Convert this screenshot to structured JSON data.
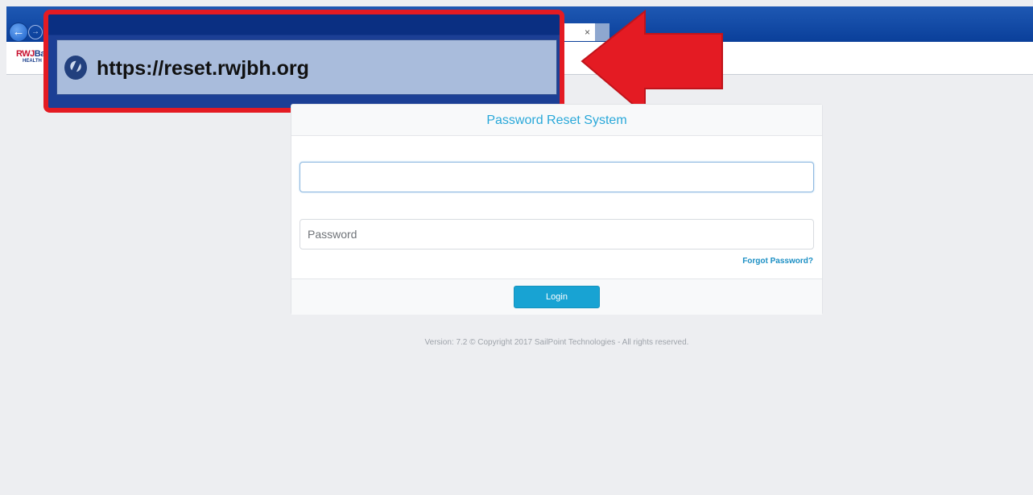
{
  "browser": {
    "tab_close": "×",
    "url": "https://reset.rwjbh.org"
  },
  "brand": {
    "logo_prefix": "RWJ",
    "logo_suffix": "Ba",
    "logo_sub": "HEALTH"
  },
  "login": {
    "title": "Password Reset System",
    "username_value": "",
    "password_placeholder": "Password",
    "forgot_label": "Forgot Password?",
    "login_label": "Login"
  },
  "footer": {
    "text": "Version: 7.2   © Copyright 2017 SailPoint Technologies - All rights reserved."
  },
  "colors": {
    "callout_red": "#e41b23",
    "accent_blue": "#18a3d3",
    "title_blue": "#29a8d9"
  },
  "icons": {
    "back": "arrow-left-icon",
    "forward": "arrow-right-icon",
    "site": "site-favicon-icon",
    "callout_arrow": "red-arrow-icon"
  }
}
